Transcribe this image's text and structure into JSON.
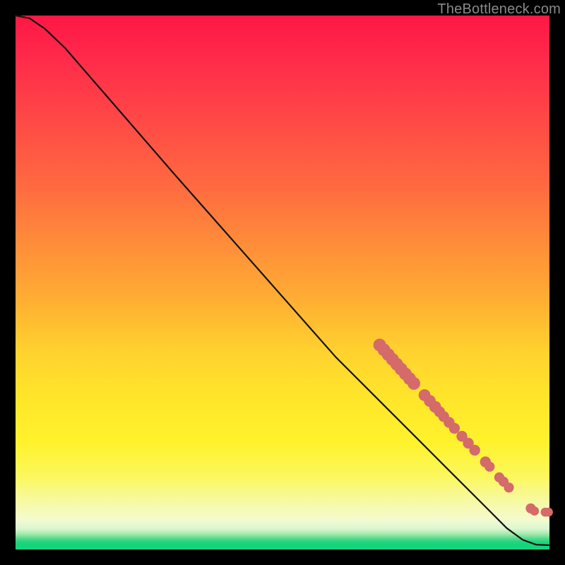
{
  "attribution": "TheBottleneck.com",
  "colors": {
    "dot": "#d46a6a",
    "curve": "#111111",
    "gradient_top": "#ff1744",
    "gradient_bottom": "#14d57c",
    "page_bg": "#000000"
  },
  "chart_data": {
    "type": "line",
    "title": "",
    "xlabel": "",
    "ylabel": "",
    "xlim": [
      0,
      100
    ],
    "ylim": [
      0,
      100
    ],
    "grid": false,
    "legend": false,
    "axes_visible": false,
    "curve": [
      {
        "x": 0.0,
        "y": 100.0
      },
      {
        "x": 2.6,
        "y": 99.5
      },
      {
        "x": 5.4,
        "y": 97.6
      },
      {
        "x": 9.2,
        "y": 94.0
      },
      {
        "x": 17.0,
        "y": 85.0
      },
      {
        "x": 30.0,
        "y": 70.0
      },
      {
        "x": 45.0,
        "y": 53.0
      },
      {
        "x": 60.0,
        "y": 36.0
      },
      {
        "x": 68.0,
        "y": 28.0
      },
      {
        "x": 75.0,
        "y": 21.0
      },
      {
        "x": 82.0,
        "y": 14.0
      },
      {
        "x": 88.0,
        "y": 8.0
      },
      {
        "x": 92.0,
        "y": 4.0
      },
      {
        "x": 95.0,
        "y": 1.8
      },
      {
        "x": 97.5,
        "y": 0.9
      },
      {
        "x": 100.0,
        "y": 0.8
      }
    ],
    "markers": [
      {
        "x": 68.2,
        "y": 38.3,
        "r": 1.4
      },
      {
        "x": 69.0,
        "y": 37.4,
        "r": 1.4
      },
      {
        "x": 69.8,
        "y": 36.5,
        "r": 1.4
      },
      {
        "x": 70.6,
        "y": 35.6,
        "r": 1.4
      },
      {
        "x": 71.4,
        "y": 34.7,
        "r": 1.4
      },
      {
        "x": 72.2,
        "y": 33.8,
        "r": 1.4
      },
      {
        "x": 73.0,
        "y": 32.9,
        "r": 1.4
      },
      {
        "x": 73.8,
        "y": 32.0,
        "r": 1.4
      },
      {
        "x": 74.6,
        "y": 31.1,
        "r": 1.4
      },
      {
        "x": 76.6,
        "y": 28.9,
        "r": 1.3
      },
      {
        "x": 77.6,
        "y": 27.8,
        "r": 1.3
      },
      {
        "x": 78.6,
        "y": 26.7,
        "r": 1.3
      },
      {
        "x": 79.4,
        "y": 25.8,
        "r": 1.2
      },
      {
        "x": 80.2,
        "y": 24.9,
        "r": 1.2
      },
      {
        "x": 81.2,
        "y": 23.8,
        "r": 1.2
      },
      {
        "x": 82.2,
        "y": 22.7,
        "r": 1.2
      },
      {
        "x": 83.6,
        "y": 21.2,
        "r": 1.2
      },
      {
        "x": 84.8,
        "y": 19.9,
        "r": 1.2
      },
      {
        "x": 86.0,
        "y": 18.6,
        "r": 1.2
      },
      {
        "x": 88.0,
        "y": 16.4,
        "r": 1.2
      },
      {
        "x": 88.8,
        "y": 15.5,
        "r": 1.1
      },
      {
        "x": 90.6,
        "y": 13.5,
        "r": 1.1
      },
      {
        "x": 91.4,
        "y": 12.7,
        "r": 1.1
      },
      {
        "x": 92.4,
        "y": 11.6,
        "r": 1.1
      },
      {
        "x": 96.5,
        "y": 7.7,
        "r": 1.1
      },
      {
        "x": 97.2,
        "y": 7.2,
        "r": 1.0
      },
      {
        "x": 99.2,
        "y": 7.0,
        "r": 1.0
      },
      {
        "x": 99.8,
        "y": 7.0,
        "r": 1.0
      }
    ]
  }
}
